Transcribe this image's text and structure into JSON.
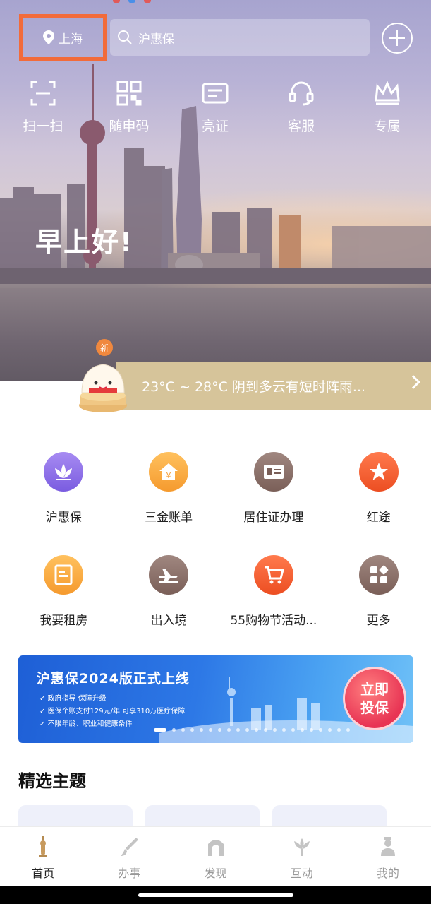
{
  "header": {
    "location": "上海",
    "search_placeholder": "沪惠保",
    "icons": [
      "location-pin-icon",
      "search-icon",
      "plus-icon"
    ]
  },
  "quick_actions": [
    {
      "label": "扫一扫",
      "icon": "scan-icon"
    },
    {
      "label": "随申码",
      "icon": "qr-code-icon"
    },
    {
      "label": "亮证",
      "icon": "card-icon"
    },
    {
      "label": "客服",
      "icon": "headset-icon"
    },
    {
      "label": "专属",
      "icon": "crown-icon"
    }
  ],
  "greeting": "早上好!",
  "weather": {
    "new_badge": "新",
    "text": "23°C ~ 28°C  阴到多云有短时阵雨..."
  },
  "services": [
    {
      "label": "沪惠保",
      "icon": "lotus-icon",
      "color": "#8a6de6"
    },
    {
      "label": "三金账单",
      "icon": "house-yen-icon",
      "color": "#f5a43a"
    },
    {
      "label": "居住证办理",
      "icon": "id-card-icon",
      "color": "#8a7068"
    },
    {
      "label": "红途",
      "icon": "star-icon",
      "color": "#f0582e"
    },
    {
      "label": "我要租房",
      "icon": "rent-document-icon",
      "color": "#f5a43a"
    },
    {
      "label": "出入境",
      "icon": "airplane-icon",
      "color": "#8a7068"
    },
    {
      "label": "55购物节活动...",
      "icon": "shopping-cart-icon",
      "color": "#f0582e"
    },
    {
      "label": "更多",
      "icon": "grid-more-icon",
      "color": "#8a7068"
    }
  ],
  "banner": {
    "title": "沪惠保2024版正式上线",
    "bullets": [
      "政府指导 保障升级",
      "医保个账支付129元/年 可享310万医疗保障",
      "不限年龄、职业和健康条件"
    ],
    "cta_line1": "立即",
    "cta_line2": "投保"
  },
  "section_title": "精选主题",
  "tabs": [
    {
      "label": "首页",
      "icon": "home-tower-icon",
      "active": true
    },
    {
      "label": "办事",
      "icon": "brush-icon",
      "active": false
    },
    {
      "label": "发现",
      "icon": "arch-icon",
      "active": false
    },
    {
      "label": "互动",
      "icon": "tulip-icon",
      "active": false
    },
    {
      "label": "我的",
      "icon": "person-icon",
      "active": false
    }
  ]
}
